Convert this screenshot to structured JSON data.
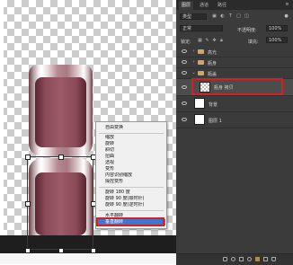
{
  "context_menu": {
    "items": [
      "自由变换",
      "缩放",
      "旋转",
      "斜切",
      "扭曲",
      "透视",
      "变形",
      "内容识别缩放",
      "操控变形",
      "旋转 180 度",
      "旋转 90 度(顺时针)",
      "旋转 90 度(逆时针)",
      "水平翻转",
      "垂直翻转"
    ],
    "highlighted": "垂直翻转"
  },
  "panel": {
    "tabs": [
      "图层",
      "通道",
      "路径"
    ],
    "kind_filter": "类型",
    "blend_mode": "正常",
    "opacity_label": "不透明度:",
    "opacity_value": "100%",
    "lock_label": "锁定:",
    "fill_label": "填充:",
    "fill_value": "100%"
  },
  "layers": [
    {
      "name": "高光",
      "type": "group"
    },
    {
      "name": "瓶身",
      "type": "group"
    },
    {
      "name": "瓶盖",
      "type": "group"
    },
    {
      "name": "瓶身 拷贝",
      "type": "layer",
      "selected": true
    },
    {
      "name": "背景",
      "type": "layer"
    },
    {
      "name": "图层 1",
      "type": "layer"
    }
  ],
  "accent_colors": {
    "highlight": "#3b79d1",
    "annotation_red": "#d31f26",
    "panel_bg": "#3b3b3b"
  }
}
